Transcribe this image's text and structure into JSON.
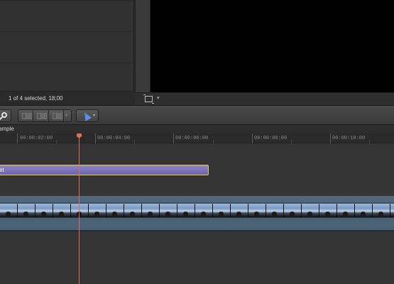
{
  "browser": {
    "status_text": "1 of 4 selected, 18;00"
  },
  "viewer_bar": {
    "crop_icon": "crop-icon",
    "crop_menu": "▾"
  },
  "toolbar": {
    "search_icon": "magnifier-icon",
    "clip_buttons_icon": "clip-connect-icons",
    "tool_icon": "select-arrow-icon",
    "tool_menu": "▾",
    "clip_menu": "▾"
  },
  "timeline": {
    "project_name": "ample",
    "ruler_labels": [
      "00:00:02:00",
      "00:00:04:00",
      "00:00:06:00",
      "00:00:08:00",
      "00:00:10:00"
    ],
    "title_clip_label": "et"
  },
  "colors": {
    "playhead": "#e06b5c",
    "title_clip": "#7a73b8",
    "title_clip_selection": "#e8d54a",
    "video_lane": "#4b6275",
    "tool_accent": "#5b8df0"
  }
}
